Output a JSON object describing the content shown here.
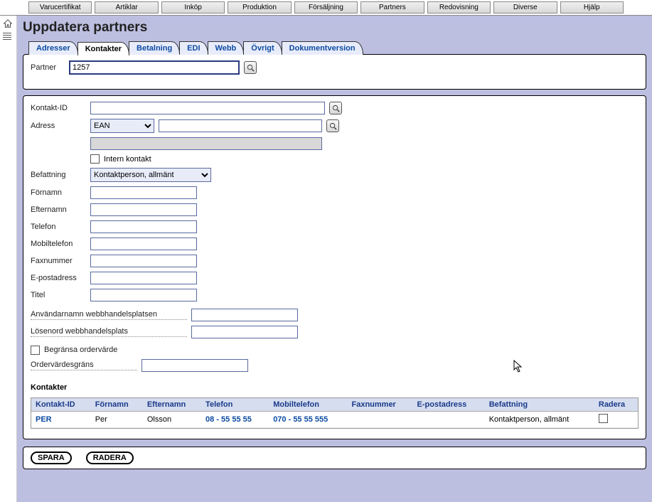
{
  "topMenu": [
    "Varucertifikat",
    "Artiklar",
    "Inköp",
    "Produktion",
    "Försäljning",
    "Partners",
    "Redovisning",
    "Diverse",
    "Hjälp"
  ],
  "pageTitle": "Uppdatera partners",
  "tabs": [
    {
      "label": "Adresser",
      "active": false
    },
    {
      "label": "Kontakter",
      "active": true
    },
    {
      "label": "Betalning",
      "active": false
    },
    {
      "label": "EDI",
      "active": false
    },
    {
      "label": "Webb",
      "active": false
    },
    {
      "label": "Övrigt",
      "active": false
    },
    {
      "label": "Dokumentversion",
      "active": false
    }
  ],
  "partner": {
    "label": "Partner",
    "value": "1257"
  },
  "form": {
    "kontaktId": {
      "label": "Kontakt-ID",
      "value": ""
    },
    "adress": {
      "label": "Adress",
      "select": "EAN",
      "input": "",
      "gray": ""
    },
    "internKontakt": {
      "label": "Intern kontakt",
      "checked": false
    },
    "befattning": {
      "label": "Befattning",
      "value": "Kontaktperson, allmänt"
    },
    "fornamn": {
      "label": "Förnamn",
      "value": ""
    },
    "efternamn": {
      "label": "Efternamn",
      "value": ""
    },
    "telefon": {
      "label": "Telefon",
      "value": ""
    },
    "mobiltelefon": {
      "label": "Mobiltelefon",
      "value": ""
    },
    "faxnummer": {
      "label": "Faxnummer",
      "value": ""
    },
    "epost": {
      "label": "E-postadress",
      "value": ""
    },
    "titel": {
      "label": "Titel",
      "value": ""
    },
    "anvandarnamn": {
      "label": "Användarnamn webbhandelsplatsen",
      "value": ""
    },
    "losenord": {
      "label": "Lösenord webbhandelsplats",
      "value": ""
    },
    "begransa": {
      "label": "Begränsa ordervärde",
      "checked": false
    },
    "ordervardesgrans": {
      "label": "Ordervärdesgräns",
      "value": ""
    }
  },
  "contactsTitle": "Kontakter",
  "table": {
    "headers": [
      "Kontakt-ID",
      "Förnamn",
      "Efternamn",
      "Telefon",
      "Mobiltelefon",
      "Faxnummer",
      "E-postadress",
      "Befattning",
      "Radera"
    ],
    "rows": [
      {
        "kontaktId": "PER",
        "fornamn": "Per",
        "efternamn": "Olsson",
        "telefon": "08 - 55 55 55",
        "mobil": "070 - 55 55 555",
        "fax": "",
        "epost": "",
        "befattning": "Kontaktperson, allmänt"
      }
    ]
  },
  "footer": {
    "save": "SPARA",
    "delete": "RADERA"
  }
}
